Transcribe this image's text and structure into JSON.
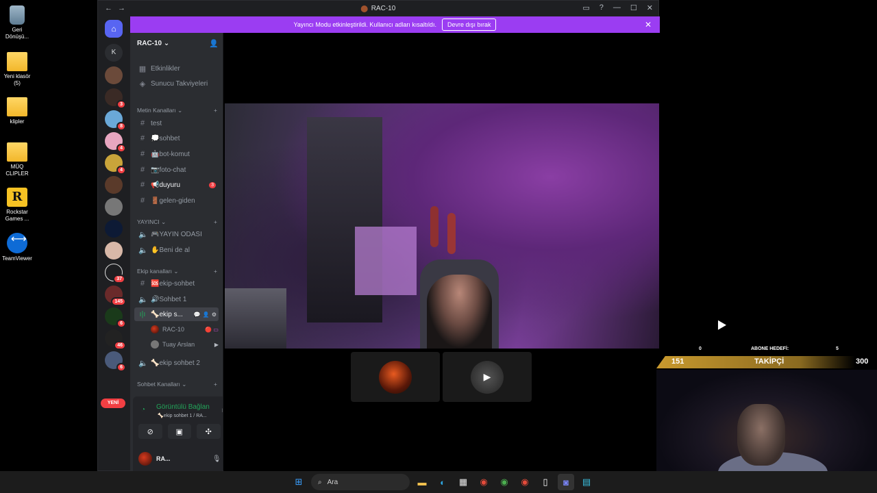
{
  "desktop": {
    "icons": [
      {
        "label": "Geri Dönüşü...",
        "kind": "bin"
      },
      {
        "label": "Yeni klasör (5)",
        "kind": "folder"
      },
      {
        "label": "klipler",
        "kind": "folder"
      },
      {
        "label": "MÜQ CLIPLER",
        "kind": "folder"
      },
      {
        "label": "Rockstar Games ...",
        "kind": "rockstar"
      },
      {
        "label": "TeamViewer",
        "kind": "teamviewer"
      }
    ]
  },
  "window": {
    "title": "RAC-10",
    "nav_icons": [
      "back-arrow",
      "forward-arrow"
    ],
    "right_icons": [
      "inbox-icon",
      "help-icon",
      "minimize",
      "maximize",
      "close"
    ]
  },
  "guilds": {
    "home_letter": "K",
    "badges": [
      "3",
      "8",
      "4",
      "4",
      "37",
      "145",
      "6",
      "46",
      "6"
    ],
    "yeni_label": "YENİ"
  },
  "banner": {
    "text": "Yayıncı Modu etkinleştirildi. Kullanıcı adları kısaltıldı.",
    "button": "Devre dışı bırak",
    "close": "✕"
  },
  "sidebar": {
    "server_name": "RAC-10",
    "top_items": [
      {
        "label": "Etkinlikler",
        "icon": "calendar-icon"
      },
      {
        "label": "Sunucu Takviyeleri",
        "icon": "boost-icon"
      }
    ],
    "categories": [
      {
        "name": "Metin Kanalları",
        "channels": [
          {
            "label": "test",
            "type": "text"
          },
          {
            "label": "💭sohbet",
            "type": "text"
          },
          {
            "label": "🤖bot-komut",
            "type": "text"
          },
          {
            "label": "📷foto-chat",
            "type": "text"
          },
          {
            "label": "📢duyuru",
            "type": "text",
            "badge": "3",
            "bright": true
          },
          {
            "label": "🚪gelen-giden",
            "type": "text"
          }
        ]
      },
      {
        "name": "YAYINCI",
        "channels": [
          {
            "label": "🎮YAYIN ODASI",
            "type": "voice"
          },
          {
            "label": "✋Beni de al",
            "type": "voice"
          }
        ]
      },
      {
        "name": "Ekip kanalları",
        "channels": [
          {
            "label": "🆘ekip-sohbet",
            "type": "text"
          },
          {
            "label": "🔊Sohbet 1",
            "type": "voice"
          },
          {
            "label": "🦴ekip s...",
            "type": "voice",
            "active": true
          },
          {
            "label": "🦴ekip sohbet 2",
            "type": "voice"
          }
        ]
      },
      {
        "name": "Sohbet Kanalları",
        "channels": []
      }
    ],
    "voice_members": [
      {
        "name": "RAC-10"
      },
      {
        "name": "Tuay Arslan"
      }
    ]
  },
  "voice_panel": {
    "status": "Görüntülü Bağlan",
    "sub": "🦴ekip sohbet 1 / RA...",
    "user_name": "RA...",
    "buttons": [
      "camera-off",
      "screen-share",
      "activities",
      "soundboard"
    ]
  },
  "stream_overlay": {
    "left_num": "0",
    "goal_label": "ABONE HEDEFİ:",
    "right_num": "5",
    "current": "151",
    "metric": "TAKİPÇİ",
    "target": "300"
  },
  "taskbar": {
    "search_placeholder": "Ara",
    "apps": [
      "windows-start",
      "search",
      "file-explorer",
      "edge",
      "store",
      "chrome",
      "chrome",
      "chrome",
      "notepad",
      "discord",
      "notes"
    ]
  },
  "colors": {
    "banner": "#9b3df2",
    "badge": "#f23f43",
    "connected": "#23a55a",
    "overlay_gold": "#c99a2e"
  }
}
